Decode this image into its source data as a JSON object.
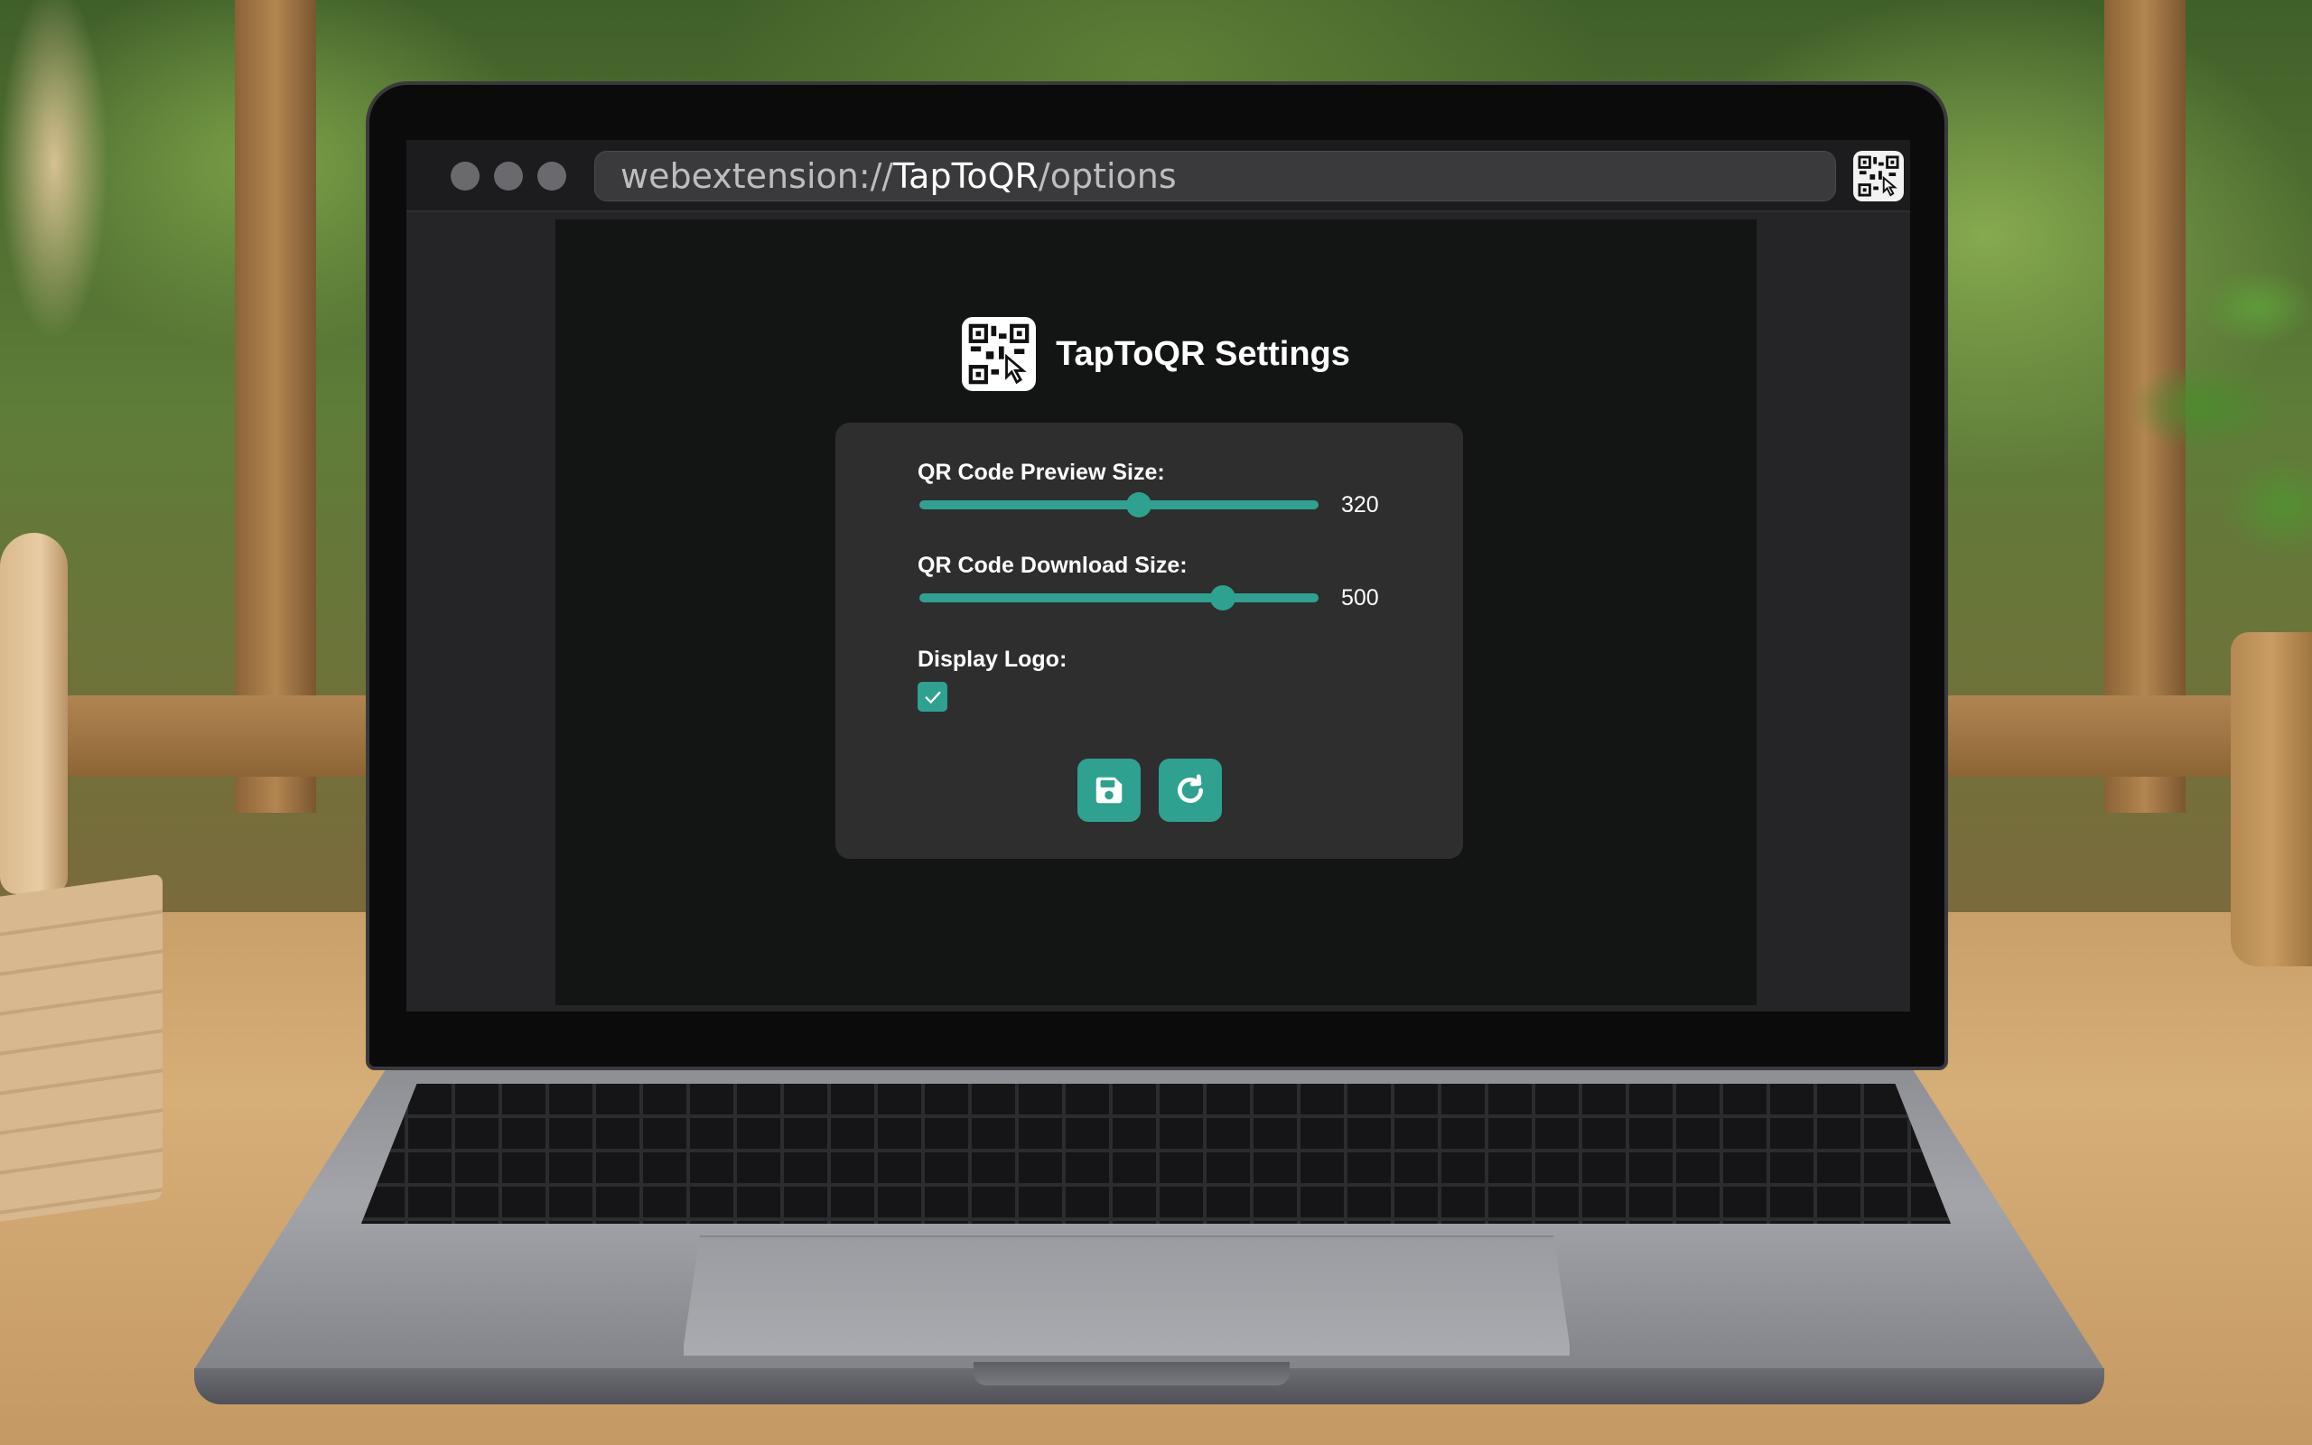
{
  "browser": {
    "url_prefix": "webextension://",
    "url_host": "TapToQR",
    "url_path": "/options",
    "extension_icon": "qr-tap-icon"
  },
  "page": {
    "title": "TapToQR Settings",
    "logo_icon": "qr-tap-icon"
  },
  "settings": {
    "preview_size": {
      "label": "QR Code Preview Size:",
      "value": "320",
      "level": 0.55
    },
    "download_size": {
      "label": "QR Code Download Size:",
      "value": "500",
      "level": 0.76
    },
    "display_logo": {
      "label": "Display Logo:",
      "checked": true
    }
  },
  "actions": {
    "save_icon": "save-icon",
    "reset_icon": "reset-icon"
  },
  "colors": {
    "accent": "#2fa190",
    "card": "#2d2e2d",
    "page_bg": "#131414"
  }
}
